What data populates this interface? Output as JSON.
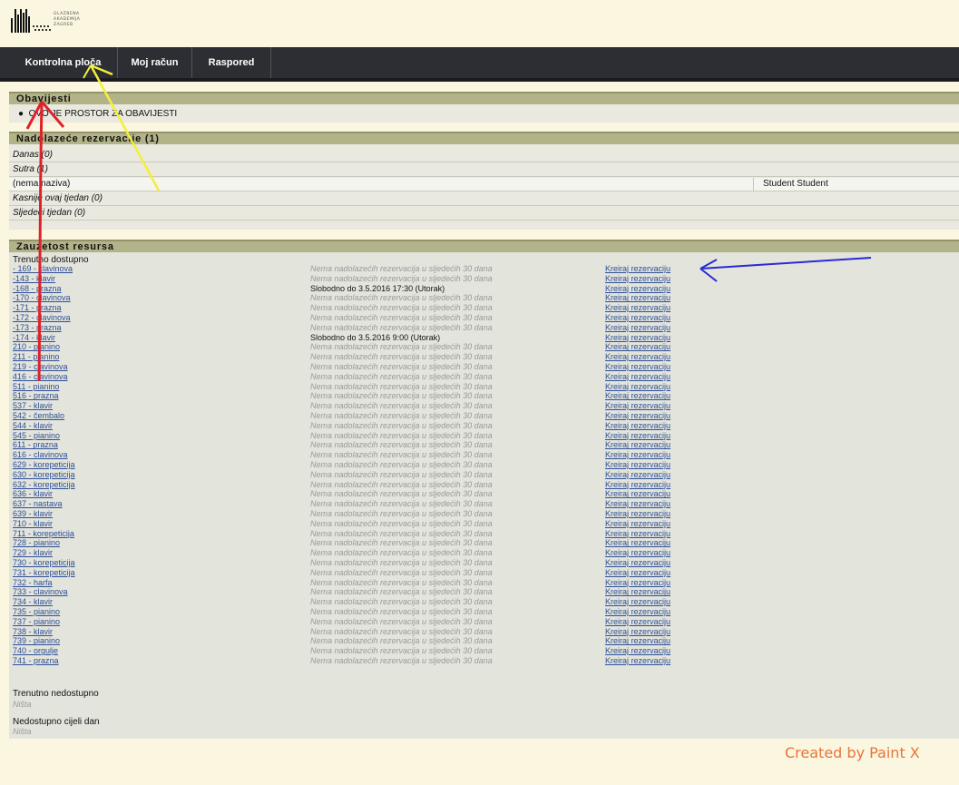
{
  "logo": {
    "lines": [
      "GLAZBENA",
      "AKADEMIJA",
      "ZAGREB"
    ]
  },
  "nav": [
    "Kontrolna ploča",
    "Moj račun",
    "Raspored"
  ],
  "notices": {
    "header": "Obavijesti",
    "items": [
      "OVO JE PROSTOR ZA OBAVIJESTI"
    ]
  },
  "upcoming": {
    "header": "Nadolazeće rezervacije (1)",
    "today": "Danas (0)",
    "tomorrow": "Sutra (1)",
    "entry_title": "(nema naziva)",
    "entry_user": "Student Student",
    "later_week": "Kasnije ovaj tjedan (0)",
    "next_week": "Sljedeći tjedan (0)"
  },
  "resources": {
    "header": "Zauzetost resursa",
    "available_label": "Trenutno dostupno",
    "unavailable_label": "Trenutno nedostupno",
    "unavailable_value": "Ništa",
    "day_unavailable_label": "Nedostupno cijeli dan",
    "day_unavailable_value": "Ništa",
    "default_status": "Nema nadolazećih rezervacija u sljedećih 30 dana",
    "action_label": "Kreiraj rezervaciju",
    "rows": [
      {
        "name": "- 169 - clavinova",
        "status": ""
      },
      {
        "name": "-143 - klavir",
        "status": ""
      },
      {
        "name": "-168 - prazna",
        "status": "Slobodno do 3.5.2016 17:30 (Utorak)"
      },
      {
        "name": "-170 - clavinova",
        "status": ""
      },
      {
        "name": "-171 - prazna",
        "status": ""
      },
      {
        "name": "-172 - clavinova",
        "status": ""
      },
      {
        "name": "-173 - prazna",
        "status": ""
      },
      {
        "name": "-174 - klavir",
        "status": "Slobodno do 3.5.2016 9:00 (Utorak)"
      },
      {
        "name": "210 - pianino",
        "status": ""
      },
      {
        "name": "211 - pianino",
        "status": ""
      },
      {
        "name": "219 - clavinova",
        "status": ""
      },
      {
        "name": "416 - clavinova",
        "status": ""
      },
      {
        "name": "511 - pianino",
        "status": ""
      },
      {
        "name": "516 - prazna",
        "status": ""
      },
      {
        "name": "537 - klavir",
        "status": ""
      },
      {
        "name": "542 - čembalo",
        "status": ""
      },
      {
        "name": "544 - klavir",
        "status": ""
      },
      {
        "name": "545 - pianino",
        "status": ""
      },
      {
        "name": "611 - prazna",
        "status": ""
      },
      {
        "name": "616 - clavinova",
        "status": ""
      },
      {
        "name": "629 - korepeticija",
        "status": ""
      },
      {
        "name": "630 - korepeticija",
        "status": ""
      },
      {
        "name": "632 - korepeticija",
        "status": ""
      },
      {
        "name": "636 - klavir",
        "status": ""
      },
      {
        "name": "637 - nastava",
        "status": ""
      },
      {
        "name": "639 - klavir",
        "status": ""
      },
      {
        "name": "710 - klavir",
        "status": ""
      },
      {
        "name": "711 - korepeticija",
        "status": ""
      },
      {
        "name": "728 - pianino",
        "status": ""
      },
      {
        "name": "729 - klavir",
        "status": ""
      },
      {
        "name": "730 - korepeticija",
        "status": ""
      },
      {
        "name": "731 - korepeticija",
        "status": ""
      },
      {
        "name": "732 - harfa",
        "status": ""
      },
      {
        "name": "733 - clavinova",
        "status": ""
      },
      {
        "name": "734 - klavir",
        "status": ""
      },
      {
        "name": "735 - pianino",
        "status": ""
      },
      {
        "name": "737 - pianino",
        "status": ""
      },
      {
        "name": "738 - klavir",
        "status": ""
      },
      {
        "name": "739 - pianino",
        "status": ""
      },
      {
        "name": "740 - orgulje",
        "status": ""
      },
      {
        "name": "741 - prazna",
        "status": ""
      }
    ]
  },
  "credit": "Created by Paint X",
  "colors": {
    "background": "#fbf6df",
    "navbar": "#2d2e33",
    "section_header": "#b3b38a",
    "link": "#2d4f96",
    "annotation_red": "#e0202a",
    "annotation_yellow": "#f2ef3a",
    "annotation_blue": "#2a2ad8"
  }
}
